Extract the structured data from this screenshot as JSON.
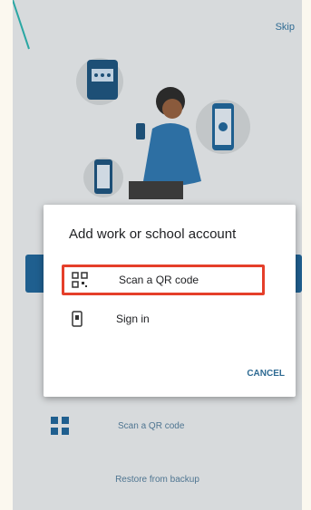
{
  "topbar": {
    "skip_label": "Skip"
  },
  "dialog": {
    "title": "Add work or school account",
    "options": [
      {
        "label": "Scan a QR code",
        "icon": "qr-code-icon"
      },
      {
        "label": "Sign in",
        "icon": "phone-login-icon"
      }
    ],
    "cancel_label": "CANCEL"
  },
  "background": {
    "scan_qr_label": "Scan a QR code",
    "restore_label": "Restore from backup"
  },
  "colors": {
    "accent": "#1f5f8f",
    "highlight": "#e53f2a"
  }
}
